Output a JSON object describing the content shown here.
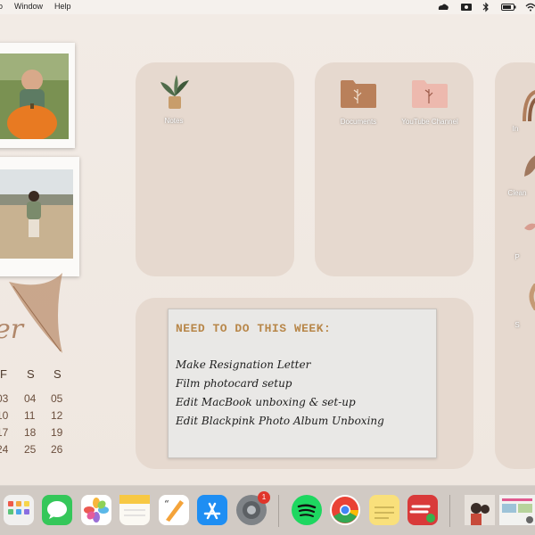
{
  "menubar": {
    "items": [
      {
        "label": "Window"
      },
      {
        "label": "Help"
      }
    ]
  },
  "desktop": {
    "icons": {
      "notes": {
        "label": "Notes"
      },
      "documents": {
        "label": "Documents"
      },
      "youtube": {
        "label": "YouTube Channel"
      },
      "right_partial": [
        {
          "label": "In"
        },
        {
          "label": "Clean"
        },
        {
          "label": "P"
        },
        {
          "label": "S"
        }
      ]
    },
    "calendar": {
      "month_partial": "er",
      "weekday_headers": [
        "F",
        "S",
        "S"
      ],
      "rows": [
        [
          "03",
          "04",
          "05"
        ],
        [
          "10",
          "11",
          "12"
        ],
        [
          "17",
          "18",
          "19"
        ],
        [
          "24",
          "25",
          "26"
        ]
      ]
    },
    "note": {
      "title": "NEED TO DO THIS WEEK:",
      "items": [
        "Make Resignation Letter",
        "Film photocard setup",
        "Edit MacBook unboxing & set-up",
        "Edit Blackpink Photo Album Unboxing"
      ]
    }
  },
  "dock": {
    "apps": [
      {
        "name": "launchpad"
      },
      {
        "name": "messages"
      },
      {
        "name": "photos"
      },
      {
        "name": "notes"
      },
      {
        "name": "pages"
      },
      {
        "name": "app-store"
      },
      {
        "name": "system-preferences",
        "badge": "1"
      },
      {
        "name": "spotify"
      },
      {
        "name": "chrome"
      },
      {
        "name": "stickies"
      },
      {
        "name": "express-vpn"
      }
    ]
  },
  "colors": {
    "panel": "#e6d9cf",
    "note_title": "#b8874a",
    "badge": "#e0352b"
  }
}
